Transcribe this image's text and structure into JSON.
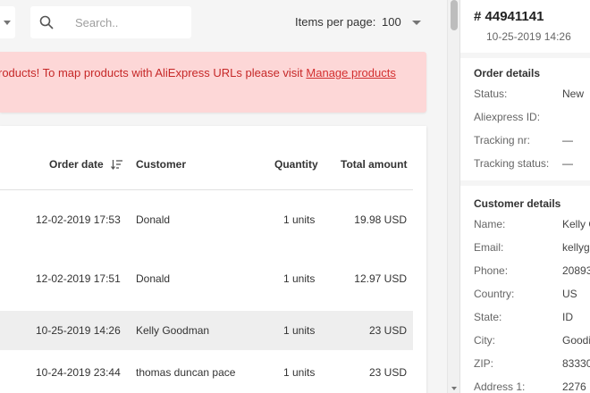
{
  "toolbar": {
    "search_placeholder": "Search..",
    "items_per_page_label": "Items per page:",
    "items_per_page_value": "100"
  },
  "alert": {
    "message": "roducts! To map products with AliExpress URLs please visit ",
    "link_text": "Manage products"
  },
  "table": {
    "headers": {
      "order_date": "Order date",
      "customer": "Customer",
      "quantity": "Quantity",
      "total": "Total amount"
    },
    "rows": [
      {
        "date": "12-02-2019 17:53",
        "customer": "Donald",
        "quantity": "1 units",
        "total": "19.98 USD",
        "selected": false
      },
      {
        "date": "12-02-2019 17:51",
        "customer": "Donald",
        "quantity": "1 units",
        "total": "12.97 USD",
        "selected": false
      },
      {
        "date": "10-25-2019 14:26",
        "customer": "Kelly Goodman",
        "quantity": "1 units",
        "total": "23 USD",
        "selected": true
      },
      {
        "date": "10-24-2019 23:44",
        "customer": "thomas duncan pace",
        "quantity": "1 units",
        "total": "23 USD",
        "selected": false
      }
    ]
  },
  "panel": {
    "order_id": "# 44941141",
    "order_date": "10-25-2019 14:26",
    "order_details": {
      "title": "Order details",
      "status_label": "Status:",
      "status_value": "New",
      "aliexpress_label": "Aliexpress ID:",
      "aliexpress_value": "",
      "tracking_label": "Tracking nr:",
      "tracking_value": "—",
      "tracking_status_label": "Tracking status:",
      "tracking_status_value": "—"
    },
    "customer_details": {
      "title": "Customer details",
      "name_label": "Name:",
      "name_value": "Kelly G",
      "email_label": "Email:",
      "email_value": "kellyg",
      "phone_label": "Phone:",
      "phone_value": "20893",
      "country_label": "Country:",
      "country_value": "US",
      "state_label": "State:",
      "state_value": "ID",
      "city_label": "City:",
      "city_value": "Goodi",
      "zip_label": "ZIP:",
      "zip_value": "83330",
      "address_label": "Address 1:",
      "address_value": "2276"
    }
  }
}
